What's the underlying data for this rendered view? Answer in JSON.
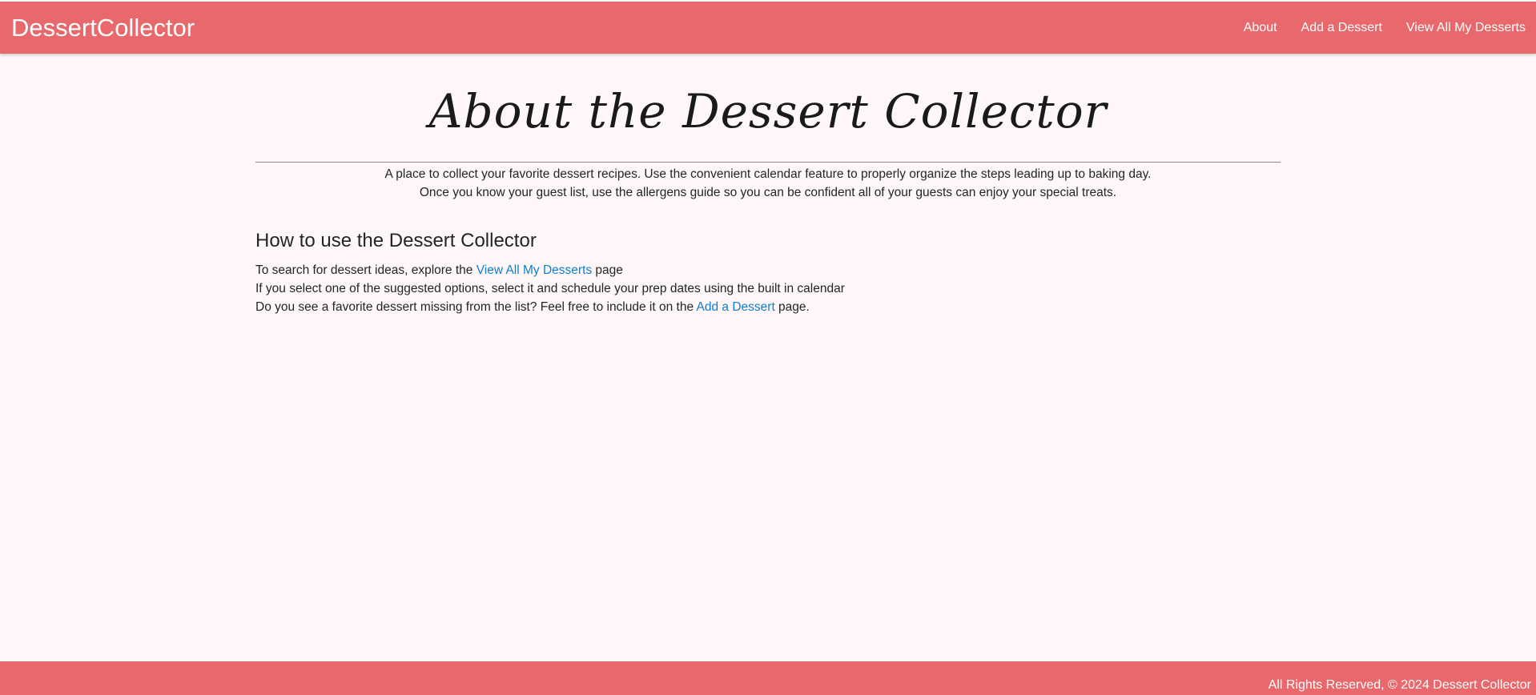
{
  "header": {
    "brand": "DessertCollector",
    "nav": {
      "about": "About",
      "add": "Add a Dessert",
      "view_all": "View All My Desserts"
    }
  },
  "main": {
    "title": "About the Dessert Collector",
    "intro": [
      "A place to collect your favorite dessert recipes. Use the convenient calendar feature to properly organize the steps leading up to baking day.",
      "Once you know your guest list, use the allergens guide so you can be confident all of your guests can enjoy your special treats."
    ],
    "howto": {
      "heading": "How to use the Dessert Collector",
      "line1_before": "To search for dessert ideas, explore the ",
      "line1_link": "View All My Desserts",
      "line1_after": " page",
      "line2": "If you select one of the suggested options, select it and schedule your prep dates using the built in calendar",
      "line3_before": "Do you see a favorite dessert missing from the list? Feel free to include it on the ",
      "line3_link": "Add a Dessert",
      "line3_after": " page."
    }
  },
  "footer": {
    "text": "All Rights Reserved, © 2024 Dessert Collector"
  },
  "colors": {
    "accent": "#e8686c",
    "background": "#fff7f7",
    "link": "#0d7fd0"
  }
}
